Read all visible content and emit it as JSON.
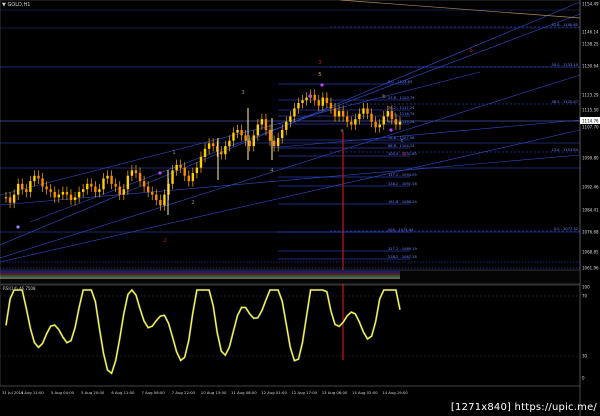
{
  "window": {
    "title": "GOLD,H1",
    "menu_icon": "triangle-down-icon"
  },
  "watermark": "[1271x840] https://upic.me/",
  "colors": {
    "background": "#000000",
    "price": "#ffd000",
    "channel": "#2e4dcc",
    "grid": "#1f2c66",
    "fib": "#3555ff",
    "red": "#c41a1a",
    "rsi": "#ffff22"
  },
  "price_axis": [
    "1154.49",
    "1146.14",
    "1138.25",
    "1130.64",
    "1123.29",
    "1115.50",
    "1107.70",
    "1099.80",
    "1092.46",
    "1084.41",
    "1076.68",
    "1068.85",
    "1061.96"
  ],
  "price_tag": "1114.76",
  "time_axis": [
    "31 Jul 2015",
    "4 Aug 11:00",
    "5 Aug 04:00",
    "5 Aug 20:00",
    "6 Aug 11:00",
    "7 Aug 06:00",
    "7 Aug 22:00",
    "10 Aug 15:00",
    "11 Aug 08:00",
    "12 Aug 01:00",
    "12 Aug 17:00",
    "13 Aug 08:00",
    "14 Aug 02:00",
    "14 Aug 19:00"
  ],
  "fib_labels": [
    "0.0 - 1123.63",
    "23.6 - 1120.79",
    "38.2 - 1117.24",
    "50.0 - 1116.74",
    "61.8 - 1115.24",
    "78.6 - 1107.58",
    "88.6 - 1104.24",
    "100.0 - 1101.65",
    "127.2 - 1094.05",
    "138.2 - 1091.16",
    "161.8 - 1086.24",
    "200 - 1075.44",
    "227.2 - 1069.19",
    "238.2 - 1067.18"
  ],
  "right_fib_labels": [
    "61.8 - 1140.65",
    "50.0 - 1133.10",
    "38.2 - 1125.67",
    "23.6 - 1103.84",
    "0.0 - 1077.32"
  ],
  "wave_labels": [
    {
      "t": "5",
      "c": "#d4a020"
    },
    {
      "t": "3",
      "c": "#c41a1a"
    },
    {
      "t": "3",
      "c": "#888888"
    },
    {
      "t": "1",
      "c": "#888888"
    },
    {
      "t": "2",
      "c": "#888888"
    },
    {
      "t": "4",
      "c": "#888888"
    },
    {
      "t": "b",
      "c": "#888888"
    },
    {
      "t": "a",
      "c": "#888888"
    },
    {
      "t": "c",
      "c": "#888888"
    },
    {
      "t": "b",
      "c": "#c41a1a"
    },
    {
      "t": "4",
      "c": "#c41a1a"
    },
    {
      "t": "2",
      "c": "#c41a1a"
    }
  ],
  "rsi": {
    "label": "RSI(14) 46.7508",
    "levels": [
      "100",
      "70",
      "30",
      "0"
    ]
  }
}
